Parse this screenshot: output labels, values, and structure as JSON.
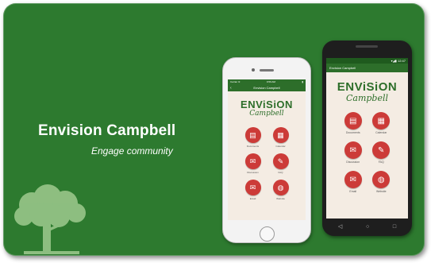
{
  "banner": {
    "title": "Envision Campbell",
    "tagline": "Engage community",
    "background": "#2d7a2f"
  },
  "iphone": {
    "status_left": "Carrier ≋",
    "status_time": "9:56 AM",
    "app_title": "Envision Campbell",
    "back_icon": "chevron-left-icon"
  },
  "android": {
    "status_time": "12:47",
    "app_title": "Envision Campbell"
  },
  "app": {
    "logo_line1": "ENViSiON",
    "logo_line2": "Campbell",
    "accent": "#cc3b38",
    "tiles": [
      {
        "label": "Documents",
        "icon": "document-icon",
        "glyph": "▤"
      },
      {
        "label": "Calendar",
        "icon": "calendar-icon",
        "glyph": "▦"
      },
      {
        "label": "Discussion",
        "icon": "chat-icon",
        "glyph": "✉"
      },
      {
        "label": "FAQ",
        "icon": "pencil-icon",
        "glyph": "✎"
      },
      {
        "label": "Email",
        "icon": "envelope-icon",
        "glyph": "✉"
      },
      {
        "label": "Website",
        "icon": "globe-icon",
        "glyph": "◍"
      }
    ]
  }
}
